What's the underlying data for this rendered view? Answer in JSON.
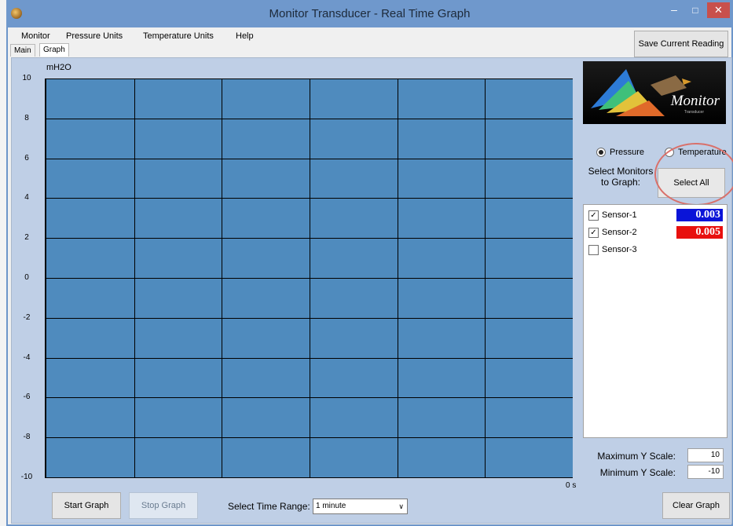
{
  "window": {
    "title": "Monitor Transducer - Real Time Graph"
  },
  "menu": [
    "Monitor",
    "Pressure Units",
    "Temperature Units",
    "Help"
  ],
  "toolbar": {
    "save_label": "Save Current Reading"
  },
  "tabs": [
    "Main",
    "Graph"
  ],
  "chart_data": {
    "type": "line",
    "ylabel": "mH2O",
    "ylim": [
      -10,
      10
    ],
    "yticks": [
      "10",
      "8",
      "6",
      "4",
      "2",
      "0",
      "-2",
      "-4",
      "-6",
      "-8",
      "-10"
    ],
    "x_end_label": "0 s",
    "x_gridlines": 6,
    "grid": true,
    "series": []
  },
  "logo": {
    "text": "Monitor",
    "sub": "Transducer"
  },
  "radio": {
    "pressure_label": "Pressure",
    "temperature_label": "Temperature",
    "selected": "Pressure"
  },
  "select": {
    "label_line1": "Select Monitors",
    "label_line2": "to Graph:",
    "select_all_label": "Select All"
  },
  "sensors": [
    {
      "label": "Sensor-1",
      "checked": true,
      "value": "0.003",
      "color": "#0a14d8"
    },
    {
      "label": "Sensor-2",
      "checked": true,
      "value": "0.005",
      "color": "#e8100e"
    },
    {
      "label": "Sensor-3",
      "checked": false,
      "value": "",
      "color": ""
    }
  ],
  "scale": {
    "max_label": "Maximum Y Scale:",
    "max_value": "10",
    "min_label": "Minimum Y Scale:",
    "min_value": "-10"
  },
  "controls": {
    "start_label": "Start Graph",
    "stop_label": "Stop Graph",
    "range_label": "Select Time Range:",
    "range_value": "1 minute",
    "clear_label": "Clear Graph"
  },
  "colors": {
    "plot_bg": "#4f8bbe",
    "panel_bg": "#bfcfe6",
    "titlebar": "#6f98cc",
    "close": "#c8504c"
  }
}
